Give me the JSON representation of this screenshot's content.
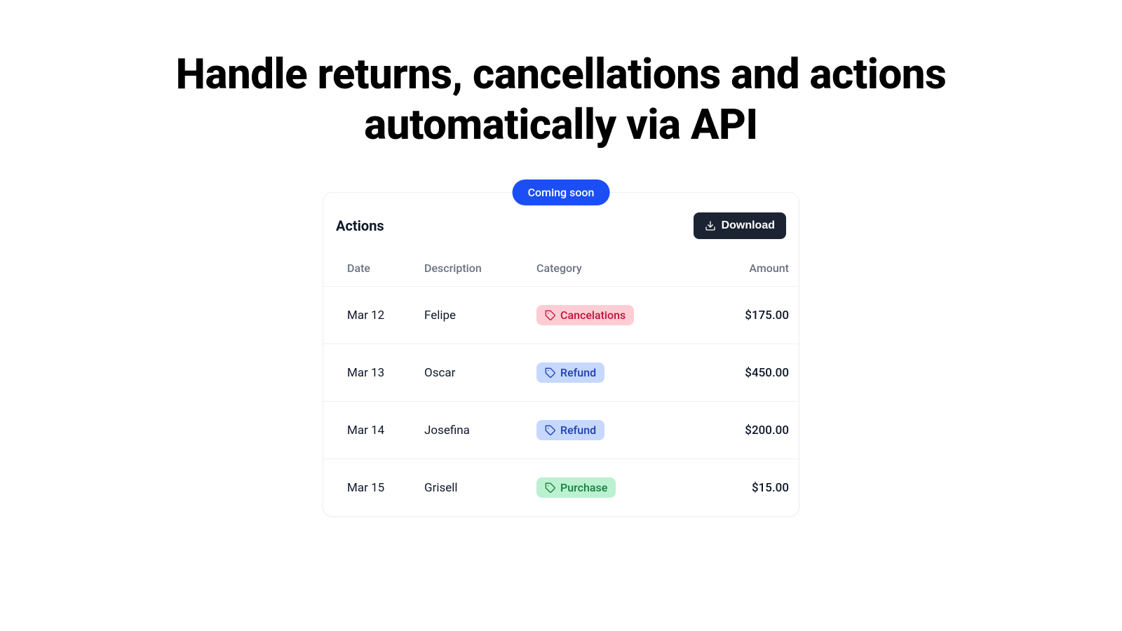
{
  "hero": {
    "title": "Handle returns, cancellations and actions automatically via API"
  },
  "badge": {
    "label": "Coming soon"
  },
  "panel": {
    "title": "Actions",
    "download_label": "Download"
  },
  "table": {
    "headers": {
      "date": "Date",
      "description": "Description",
      "category": "Category",
      "amount": "Amount"
    },
    "rows": [
      {
        "date": "Mar 12",
        "description": "Felipe",
        "category": "Cancelations",
        "category_type": "cancel",
        "amount": "$175.00"
      },
      {
        "date": "Mar 13",
        "description": "Oscar",
        "category": "Refund",
        "category_type": "refund",
        "amount": "$450.00"
      },
      {
        "date": "Mar 14",
        "description": "Josefina",
        "category": "Refund",
        "category_type": "refund",
        "amount": "$200.00"
      },
      {
        "date": "Mar 15",
        "description": "Grisell",
        "category": "Purchase",
        "category_type": "purchase",
        "amount": "$15.00"
      }
    ]
  },
  "colors": {
    "accent": "#1b4ef5",
    "cancel_bg": "#fecdd3",
    "cancel_fg": "#be123c",
    "refund_bg": "#c7d8fe",
    "refund_fg": "#1e40af",
    "purchase_bg": "#bbf0d0",
    "purchase_fg": "#15803d"
  }
}
